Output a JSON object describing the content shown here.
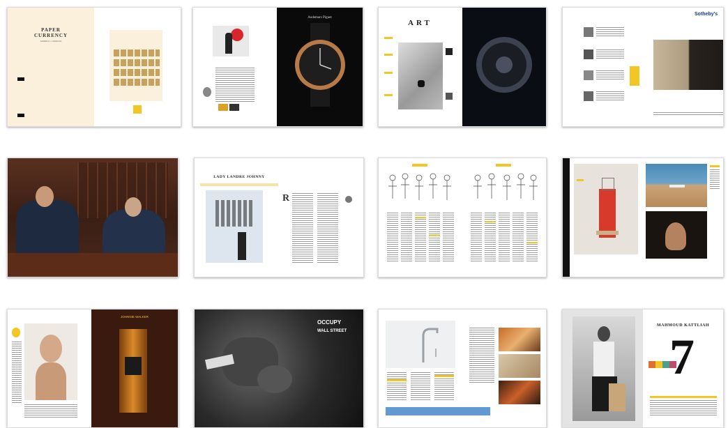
{
  "spreads": [
    {
      "id": "cover",
      "title_line1": "PAPER",
      "title_line2": "CURRENCY",
      "subtitle": "ANDREA L. CORDOVA"
    },
    {
      "id": "audemars",
      "brand": "Audemars Piguet"
    },
    {
      "id": "art",
      "heading": "ART"
    },
    {
      "id": "sothebys",
      "brand": "Sotheby's"
    },
    {
      "id": "portrait"
    },
    {
      "id": "gallery",
      "heading": "LADY LANDRE JOHNNY"
    },
    {
      "id": "illustrations"
    },
    {
      "id": "installation"
    },
    {
      "id": "whisky",
      "ad_text": "JOHNNIE WALKER"
    },
    {
      "id": "occupy",
      "headline_1": "OCCUPY",
      "headline_2": "WALL STREET"
    },
    {
      "id": "faucet"
    },
    {
      "id": "seven",
      "name": "MAHMOUD KATTLIAH",
      "number": "7"
    }
  ],
  "colors": {
    "accent_yellow": "#f3c623",
    "cream": "#fbf0dc",
    "black_ad": "#0a0a0a",
    "sothebys_blue": "#1a3a8c"
  }
}
